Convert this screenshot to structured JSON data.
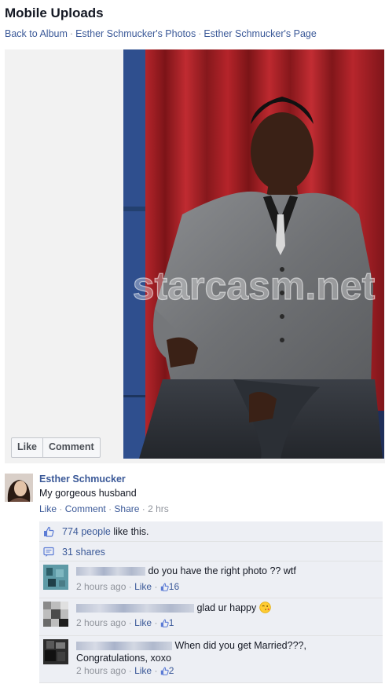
{
  "header": {
    "title": "Mobile Uploads",
    "breadcrumbs": [
      "Back to Album",
      "Esther Schmucker's Photos",
      "Esther Schmucker's Page"
    ],
    "separator": "·"
  },
  "photo": {
    "watermark": "starcasm.net",
    "actions": {
      "like_label": "Like",
      "comment_label": "Comment"
    }
  },
  "post": {
    "author": "Esther Schmucker",
    "caption": "My gorgeous husband",
    "actions": {
      "like": "Like",
      "comment": "Comment",
      "share": "Share",
      "time": "2 hrs"
    }
  },
  "ufi": {
    "likes_link": "774 people",
    "likes_suffix": " like this.",
    "shares": "31 shares",
    "comments": [
      {
        "text": "do you have the right photo ?? wtf",
        "time": "2 hours ago",
        "like_label": "Like",
        "like_count": "16"
      },
      {
        "text": "glad ur happy",
        "time": "2 hours ago",
        "like_label": "Like",
        "like_count": "1"
      },
      {
        "text": "When did you get Married???, Congratulations, xoxo",
        "time": "2 hours ago",
        "like_label": "Like",
        "like_count": "2"
      }
    ]
  },
  "icons": {
    "like": "thumbs-up-icon",
    "share": "share-icon",
    "emoji": "kiss-wink-emoji-icon"
  },
  "colors": {
    "link": "#3b5998",
    "meta": "#90949c",
    "ufi_bg": "#edeff4"
  }
}
